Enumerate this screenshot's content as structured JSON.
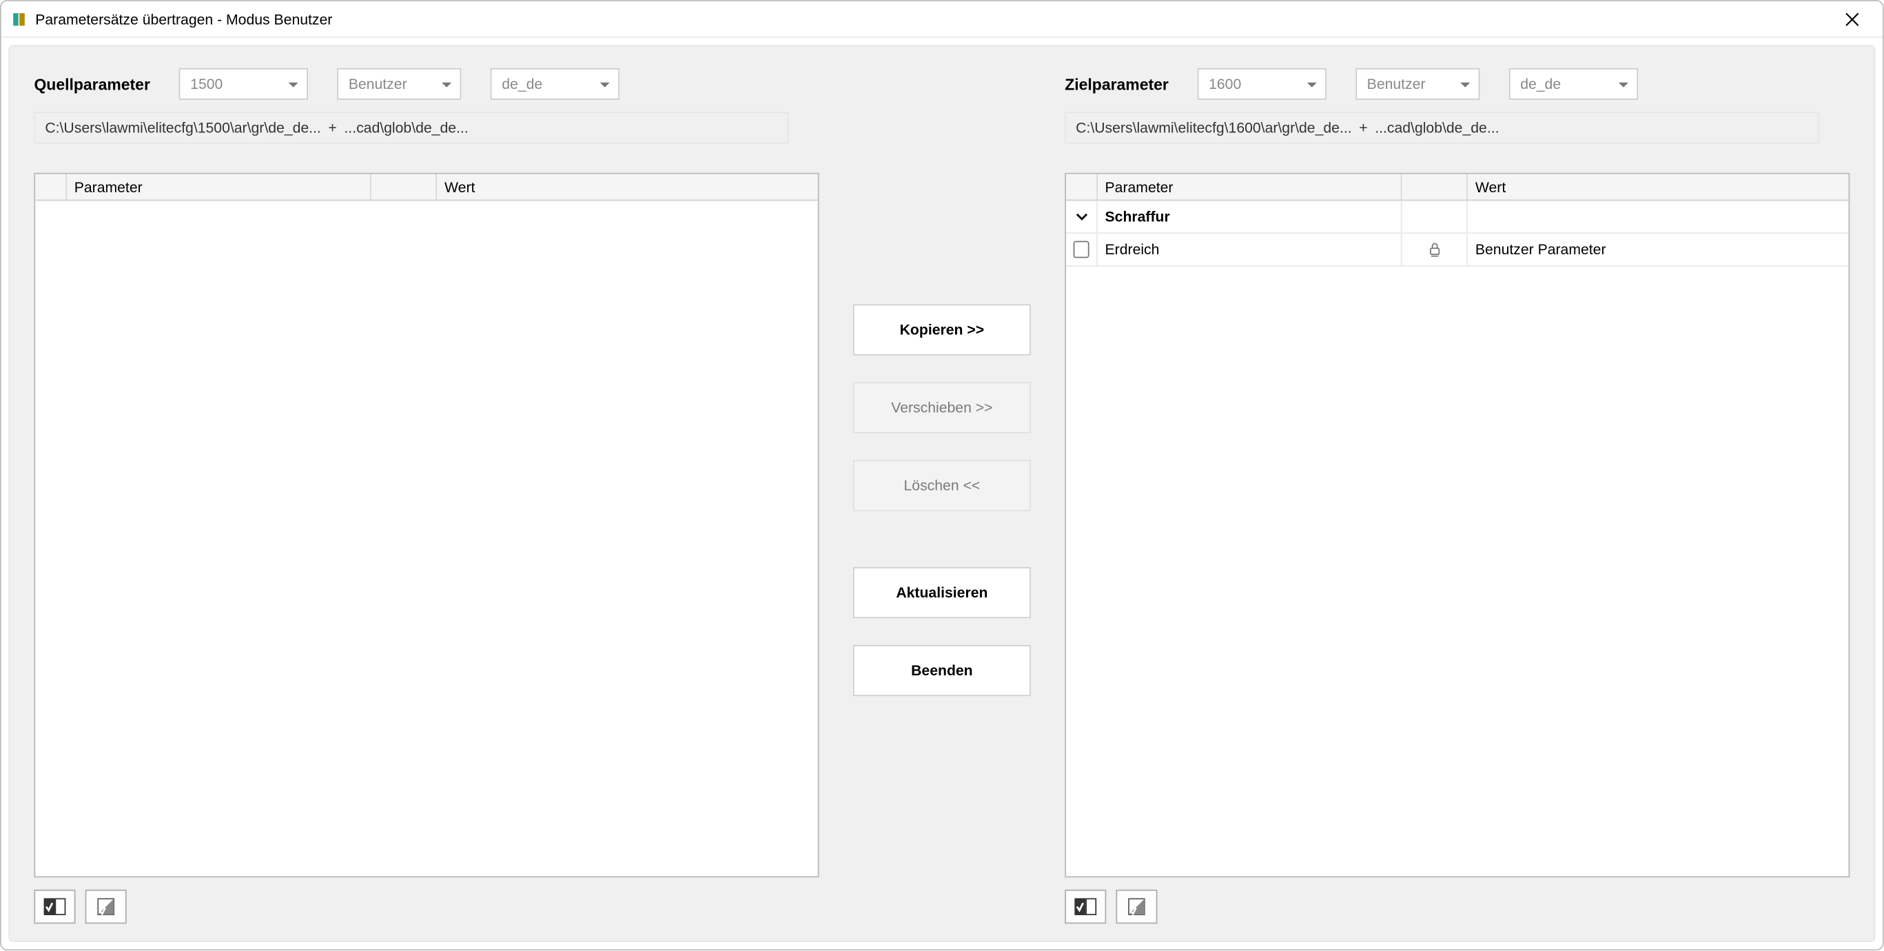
{
  "window": {
    "title": "Parametersätze übertragen - Modus Benutzer"
  },
  "source": {
    "title": "Quellparameter",
    "version": "1500",
    "mode": "Benutzer",
    "lang": "de_de",
    "path1": "C:\\Users\\lawmi\\elitecfg\\1500\\ar\\gr\\de_de...",
    "path2": "...cad\\glob\\de_de...",
    "columns": {
      "param": "Parameter",
      "value": "Wert"
    },
    "rows": []
  },
  "target": {
    "title": "Zielparameter",
    "version": "1600",
    "mode": "Benutzer",
    "lang": "de_de",
    "path1": "C:\\Users\\lawmi\\elitecfg\\1600\\ar\\gr\\de_de...",
    "path2": "...cad\\glob\\de_de...",
    "columns": {
      "param": "Parameter",
      "value": "Wert"
    },
    "group": {
      "name": "Schraffur"
    },
    "rows": [
      {
        "name": "Erdreich",
        "value": "Benutzer Parameter"
      }
    ]
  },
  "actions": {
    "copy": "Kopieren >>",
    "move": "Verschieben >>",
    "delete": "Löschen <<",
    "refresh": "Aktualisieren",
    "exit": "Beenden"
  }
}
